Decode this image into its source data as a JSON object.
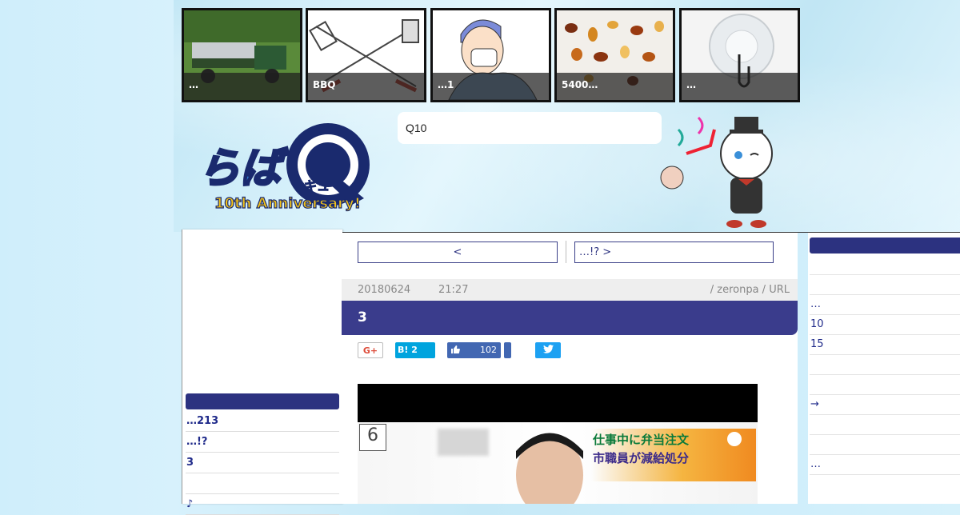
{
  "header": {
    "thumbnails": [
      {
        "caption": "…",
        "image": "truck-photo"
      },
      {
        "caption": "BBQ",
        "image": "bbq-tools-illustration"
      },
      {
        "caption": "…1",
        "image": "surgeon-illustration"
      },
      {
        "caption": "5400…",
        "image": "amber-stones-photo"
      },
      {
        "caption": "…",
        "image": "suction-hook-photo"
      }
    ],
    "search_value": "Q10",
    "logo": {
      "main": "らば",
      "sub": "キュー",
      "anniversary": "10th Anniversary!"
    }
  },
  "article": {
    "nav": {
      "prev": "<",
      "next": "…!? >"
    },
    "date": "20180624",
    "time": "21:27",
    "author": "/ zeronpa / URL",
    "title": "3",
    "share": {
      "gplus": "G+",
      "hatena_label": "B!",
      "hatena_count": "2",
      "fb_count": "102"
    },
    "video_caption_line1": "仕事中に弁当注文",
    "video_caption_line2": "市職員が減給処分",
    "video_channel": "6"
  },
  "left_sidebar": {
    "items": [
      "…213",
      "…!?",
      "3",
      "",
      "♪"
    ]
  },
  "right_sidebar": {
    "items": [
      "",
      "",
      "…",
      "10",
      "15",
      "",
      "",
      "→",
      "",
      "",
      "…"
    ]
  },
  "colors": {
    "accent": "#2c3280",
    "title_bar": "#3a3c8c",
    "facebook": "#4267b2",
    "twitter": "#1da1f2",
    "hatena": "#00a4de"
  }
}
